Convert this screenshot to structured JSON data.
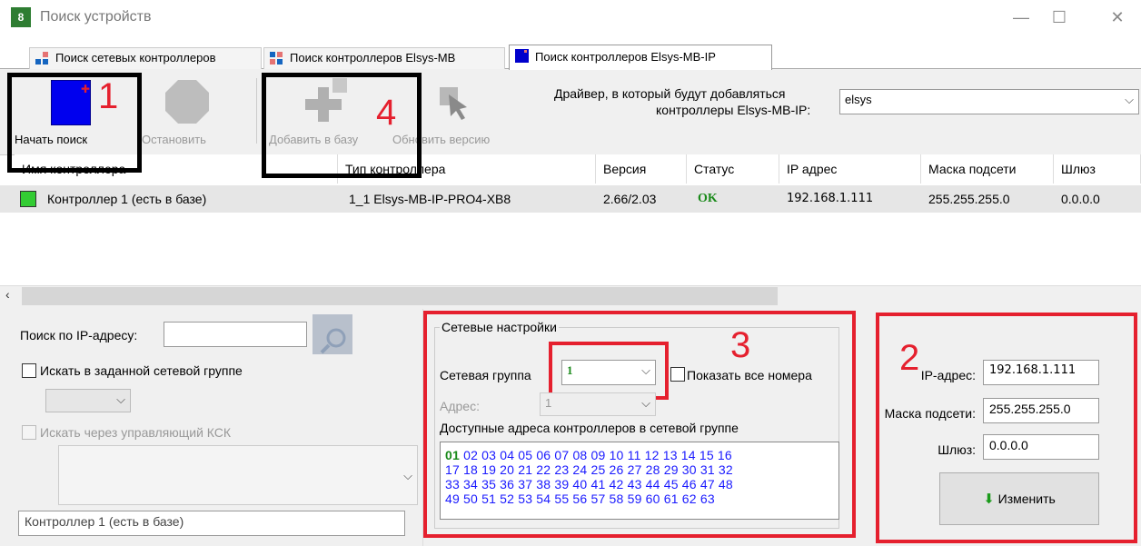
{
  "window": {
    "title": "Поиск устройств",
    "minimize": "—",
    "maximize": "☐",
    "close": "✕"
  },
  "tabs": [
    {
      "label": "Поиск сетевых контроллеров",
      "icon": "network-controllers-icon"
    },
    {
      "label": "Поиск контроллеров Elsys-MB",
      "icon": "mb-controllers-icon"
    },
    {
      "label": "Поиск контроллеров Elsys-MB-IP",
      "icon": "mb-ip-controllers-icon",
      "active": true
    }
  ],
  "toolbar": {
    "start_search": "Начать поиск",
    "stop": "Остановить",
    "add_to_db": "Добавить в базу",
    "update_version": "Обновить версию",
    "driver_label_line1": "Драйвер, в который будут добавляться",
    "driver_label_line2": "контроллеры Elsys-MB-IP:",
    "driver_value": "elsys"
  },
  "table": {
    "columns": [
      "Имя контроллера",
      "Тип контроллера",
      "Версия",
      "Статус",
      "IP адрес",
      "Маска подсети",
      "Шлюз"
    ],
    "rows": [
      {
        "name": "Контроллер 1 (есть в базе)",
        "type": "1_1 Elsys-MB-IP-PRO4-XB8",
        "version": "2.66/2.03",
        "status": "OK",
        "ip": "192.168.1.111",
        "mask": "255.255.255.0",
        "gateway": "0.0.0.0"
      }
    ]
  },
  "search": {
    "ip_label": "Поиск по IP-адресу:",
    "ip_value": "",
    "in_group_label": "Искать в заданной сетевой группе",
    "via_ksk_label": "Искать через управляющий КСК",
    "selected_controller": "Контроллер 1 (есть в базе)"
  },
  "network": {
    "group_title": "Сетевые настройки",
    "group_label": "Сетевая группа",
    "group_value": "1",
    "show_all_label": "Показать все номера",
    "address_label": "Адрес:",
    "address_value": "1",
    "available_label": "Доступные адреса контроллеров в сетевой группе",
    "address_lines": [
      "02 03 04 05 06 07 08 09 10 11 12 13 14 15 16",
      "17 18 19 20 21 22 23 24 25 26 27 28 29 30 31 32",
      "33 34 35 36 37 38 39 40 41 42 43 44 45 46 47 48",
      "49 50 51 52 53 54 55 56 57 58 59 60 61 62 63"
    ],
    "first_address": "01"
  },
  "ipconfig": {
    "ip_label": "IP-адрес:",
    "ip_value": "192.168.1.111",
    "mask_label": "Маска подсети:",
    "mask_value": "255.255.255.0",
    "gateway_label": "Шлюз:",
    "gateway_value": "0.0.0.0",
    "apply": "Изменить"
  },
  "annotations": {
    "n1": "1",
    "n2": "2",
    "n3": "3",
    "n4": "4"
  },
  "colors": {
    "accent_red": "#e5202e",
    "ok_green": "#1a8a1a",
    "address_blue": "#1a1aff",
    "status_indicator": "#33cc33"
  }
}
